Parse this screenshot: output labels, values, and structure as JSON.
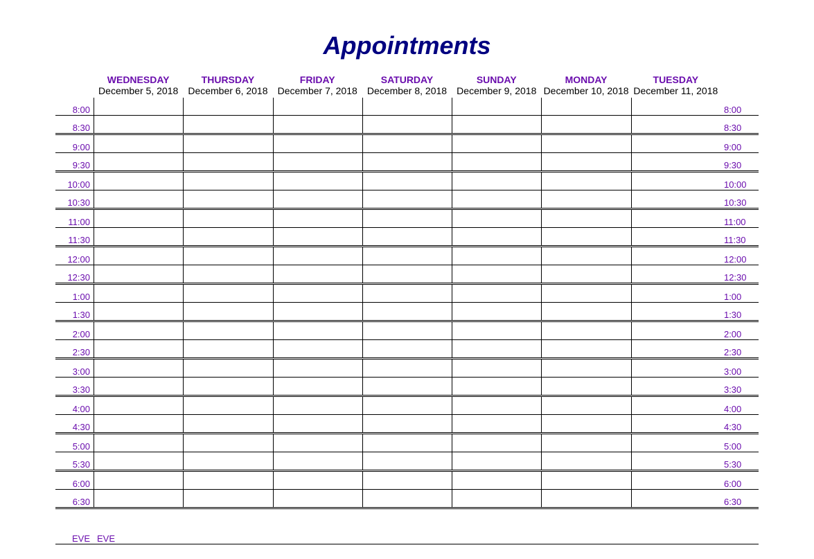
{
  "title": "Appointments",
  "days": [
    {
      "name": "WEDNESDAY",
      "date": "December 5, 2018"
    },
    {
      "name": "THURSDAY",
      "date": "December 6, 2018"
    },
    {
      "name": "FRIDAY",
      "date": "December 7, 2018"
    },
    {
      "name": "SATURDAY",
      "date": "December 8, 2018"
    },
    {
      "name": "SUNDAY",
      "date": "December 9, 2018"
    },
    {
      "name": "MONDAY",
      "date": "December 10, 2018"
    },
    {
      "name": "TUESDAY",
      "date": "December 11, 2018"
    }
  ],
  "times": [
    "8:00",
    "8:30",
    "9:00",
    "9:30",
    "10:00",
    "10:30",
    "11:00",
    "11:30",
    "12:00",
    "12:30",
    "1:00",
    "1:30",
    "2:00",
    "2:30",
    "3:00",
    "3:30",
    "4:00",
    "4:30",
    "5:00",
    "5:30",
    "6:00",
    "6:30"
  ],
  "eve_label": "EVE"
}
